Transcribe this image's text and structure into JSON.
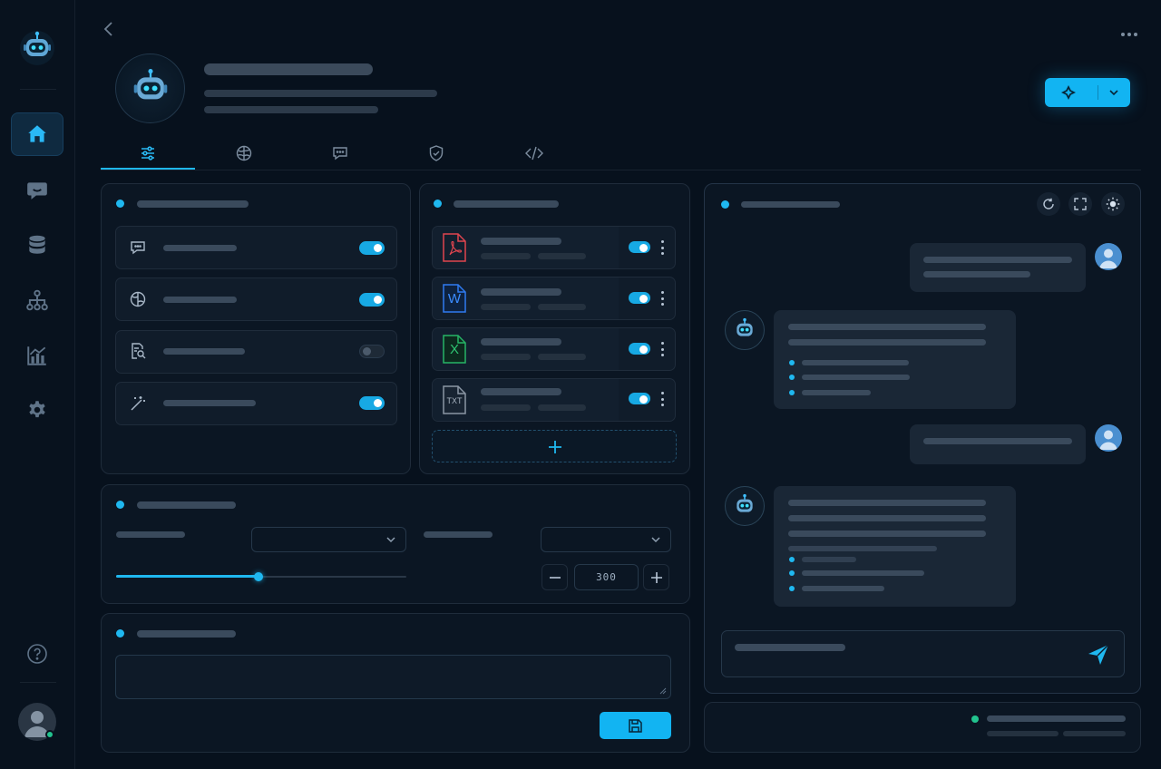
{
  "sidebar": {
    "items": [
      {
        "icon": "home-icon",
        "active": true
      },
      {
        "icon": "chat-icon"
      },
      {
        "icon": "database-icon"
      },
      {
        "icon": "workflow-icon"
      },
      {
        "icon": "analytics-icon"
      },
      {
        "icon": "settings-icon"
      }
    ]
  },
  "header": {
    "tabs": [
      {
        "icon": "sliders-icon",
        "active": true
      },
      {
        "icon": "brain-icon"
      },
      {
        "icon": "message-icon"
      },
      {
        "icon": "shield-icon"
      },
      {
        "icon": "code-icon"
      }
    ]
  },
  "settings": {
    "toggles": [
      {
        "icon": "chat-bubble-icon",
        "enabled": true
      },
      {
        "icon": "brain-icon",
        "enabled": true
      },
      {
        "icon": "doc-search-icon",
        "enabled": false
      },
      {
        "icon": "magic-wand-icon",
        "enabled": true
      }
    ]
  },
  "knowledge": {
    "files": [
      {
        "type_label": "",
        "icon": "pdf-file-icon",
        "color": "#e0454f",
        "enabled": true
      },
      {
        "type_label": "W",
        "icon": "word-file-icon",
        "color": "#2f7bf0",
        "enabled": true
      },
      {
        "type_label": "X",
        "icon": "excel-file-icon",
        "color": "#26b466",
        "enabled": true
      },
      {
        "type_label": "TXT",
        "icon": "txt-file-icon",
        "color": "#8a96a4",
        "enabled": true
      }
    ]
  },
  "model_params": {
    "slider_value": 0.49,
    "max_tokens": "300"
  },
  "colors": {
    "accent": "#1fb8f0",
    "background": "#07111d",
    "panel": "#0b1623",
    "status_online": "#22c38e"
  }
}
